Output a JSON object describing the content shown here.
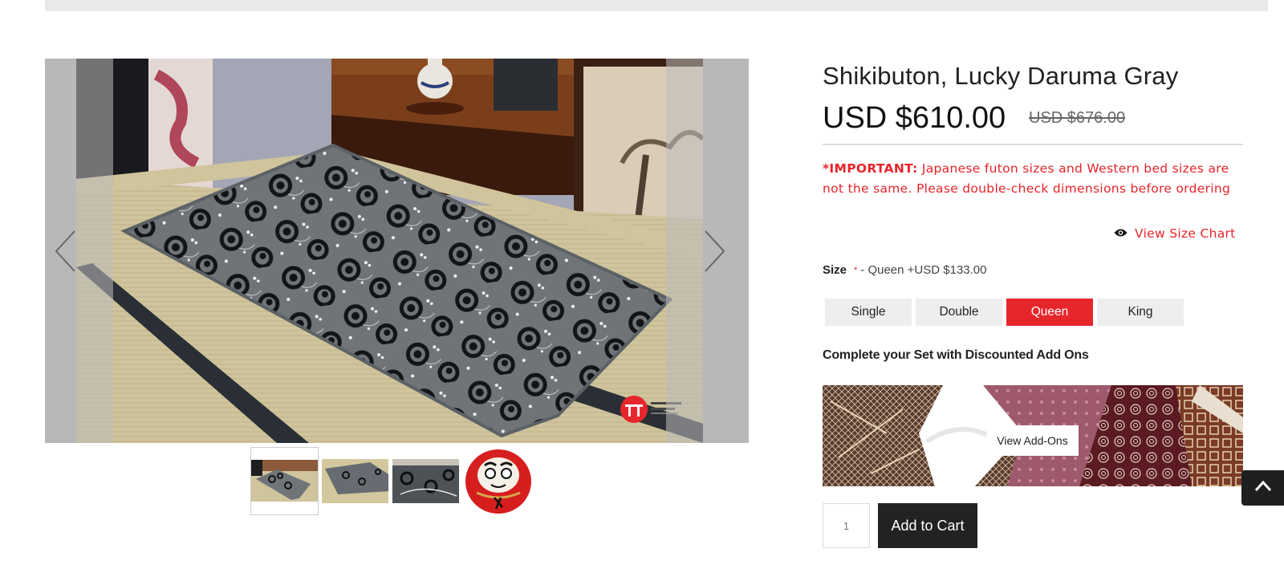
{
  "product": {
    "title": "Shikibuton, Lucky Daruma Gray",
    "price": "USD $610.00",
    "compare_price": "USD $676.00",
    "notice_prefix": "*IMPORTANT:",
    "notice_text": " Japanese futon sizes and Western bed sizes are not the same. Please double-check dimensions before ordering",
    "size_chart_label": "View Size Chart",
    "size_label": "Size",
    "size_required_marker": "*",
    "size_selected_text": "- Queen +USD $133.00",
    "size_options": [
      "Single",
      "Double",
      "Queen",
      "King"
    ],
    "selected_size": "Queen",
    "addons_heading": "Complete your Set with Discounted Add Ons",
    "view_addons_label": "View Add-Ons",
    "quantity_placeholder": "1",
    "add_to_cart_label": "Add to Cart"
  },
  "gallery": {
    "thumbnail_count": 4,
    "active_thumbnail": 1
  },
  "colors": {
    "accent_red": "#e7262c",
    "text_dark": "#222222",
    "button_dark": "#222222",
    "option_bg": "#eeeeee"
  },
  "icons": {
    "prev": "chevron-left-icon",
    "next": "chevron-right-icon",
    "size_chart": "eye-icon",
    "back_to_top": "chevron-up-icon"
  }
}
